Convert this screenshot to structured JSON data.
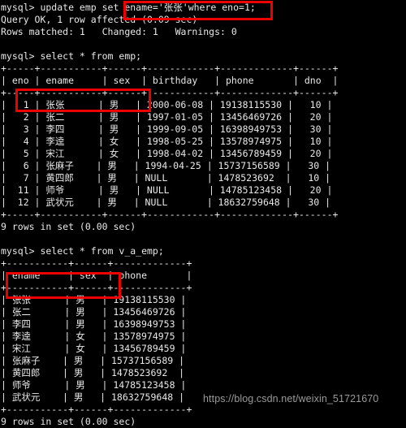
{
  "terminal": {
    "prompt": "mysql> ",
    "lines": [
      "mysql> update emp set ename='张张'where eno=1;",
      "Query OK, 1 row affected (0.09 sec)",
      "Rows matched: 1   Changed: 1   Warnings: 0",
      "",
      "mysql> select * from emp;",
      "+-----+-----------+------+------------+-------------+------+",
      "| eno | ename     | sex  | birthday   | phone       | dno  |",
      "+-----+-----------+------+------------+-------------+------+",
      "|   1 | 张张      | 男   | 2000-06-08 | 19138115530 |   10 |",
      "|   2 | 张二      | 男   | 1997-01-05 | 13456469726 |   20 |",
      "|   3 | 李四      | 男   | 1999-09-05 | 16398949753 |   30 |",
      "|   4 | 李逵      | 女   | 1998-05-25 | 13578974975 |   10 |",
      "|   5 | 宋江      | 女   | 1998-04-02 | 13456789459 |   20 |",
      "|   6 | 张麻子    | 男   | 1994-04-25 | 15737156589 |   30 |",
      "|   7 | 黄四郎    | 男   | NULL       | 1478523692  |   10 |",
      "|  11 | 师爷      | 男   | NULL       | 14785123458 |   20 |",
      "|  12 | 武状元    | 男   | NULL       | 18632759648 |   30 |",
      "+-----+-----------+------+------------+-------------+------+",
      "9 rows in set (0.00 sec)",
      "",
      "mysql> select * from v_a_emp;",
      "+-----------+------+-------------+",
      "| ename     | sex  | phone       |",
      "+-----------+------+-------------+",
      "| 张张      | 男   | 19138115530 |",
      "| 张二      | 男   | 13456469726 |",
      "| 李四      | 男   | 16398949753 |",
      "| 李逵      | 女   | 13578974975 |",
      "| 宋江      | 女   | 13456789459 |",
      "| 张麻子    | 男   | 15737156589 |",
      "| 黄四郎    | 男   | 1478523692  |",
      "| 师爷      | 男   | 14785123458 |",
      "| 武状元    | 男   | 18632759648 |",
      "+-----------+------+-------------+",
      "9 rows in set (0.00 sec)"
    ],
    "colors": {
      "background": "#000000",
      "foreground": "#e8e8e8",
      "annotation": "#ee0000",
      "watermark": "#9a9a9a"
    }
  },
  "statements": {
    "update_statement": "mysql> update emp set ename='张张'where eno=1;",
    "update_result_ok": "Query OK, 1 row affected (0.09 sec)",
    "update_result_matched": "Rows matched: 1   Changed: 1   Warnings: 0",
    "select_emp_statement": "mysql> select * from emp;",
    "select_emp_rowcount": "9 rows in set (0.00 sec)",
    "select_view_statement": "mysql> select * from v_a_emp;",
    "select_view_rowcount": "9 rows in set (0.00 sec)"
  },
  "emp_table": {
    "name": "emp",
    "columns": [
      "eno",
      "ename",
      "sex",
      "birthday",
      "phone",
      "dno"
    ],
    "rows": [
      [
        "1",
        "张张",
        "男",
        "2000-06-08",
        "19138115530",
        "10"
      ],
      [
        "2",
        "张二",
        "男",
        "1997-01-05",
        "13456469726",
        "20"
      ],
      [
        "3",
        "李四",
        "男",
        "1999-09-05",
        "16398949753",
        "30"
      ],
      [
        "4",
        "李逵",
        "女",
        "1998-05-25",
        "13578974975",
        "10"
      ],
      [
        "5",
        "宋江",
        "女",
        "1998-04-02",
        "13456789459",
        "20"
      ],
      [
        "6",
        "张麻子",
        "男",
        "1994-04-25",
        "15737156589",
        "30"
      ],
      [
        "7",
        "黄四郎",
        "男",
        "NULL",
        "1478523692",
        "10"
      ],
      [
        "11",
        "师爷",
        "男",
        "NULL",
        "14785123458",
        "20"
      ],
      [
        "12",
        "武状元",
        "男",
        "NULL",
        "18632759648",
        "30"
      ]
    ]
  },
  "view_table": {
    "name": "v_a_emp",
    "columns": [
      "ename",
      "sex",
      "phone"
    ],
    "rows": [
      [
        "张张",
        "男",
        "19138115530"
      ],
      [
        "张二",
        "男",
        "13456469726"
      ],
      [
        "李四",
        "男",
        "16398949753"
      ],
      [
        "李逵",
        "女",
        "13578974975"
      ],
      [
        "宋江",
        "女",
        "13456789459"
      ],
      [
        "张麻子",
        "男",
        "15737156589"
      ],
      [
        "黄四郎",
        "男",
        "1478523692"
      ],
      [
        "师爷",
        "男",
        "14785123458"
      ],
      [
        "武状元",
        "男",
        "18632759648"
      ]
    ]
  },
  "annotations": [
    {
      "name": "update-set-clause",
      "text": "ename='张张'where eno=1;"
    },
    {
      "name": "emp-first-row",
      "text": "|   1 | 张张      | 男   |"
    },
    {
      "name": "view-first-row",
      "text": "| 张张      | 男   |"
    }
  ],
  "watermark": {
    "text": "https://blog.csdn.net/weixin_51721670"
  }
}
